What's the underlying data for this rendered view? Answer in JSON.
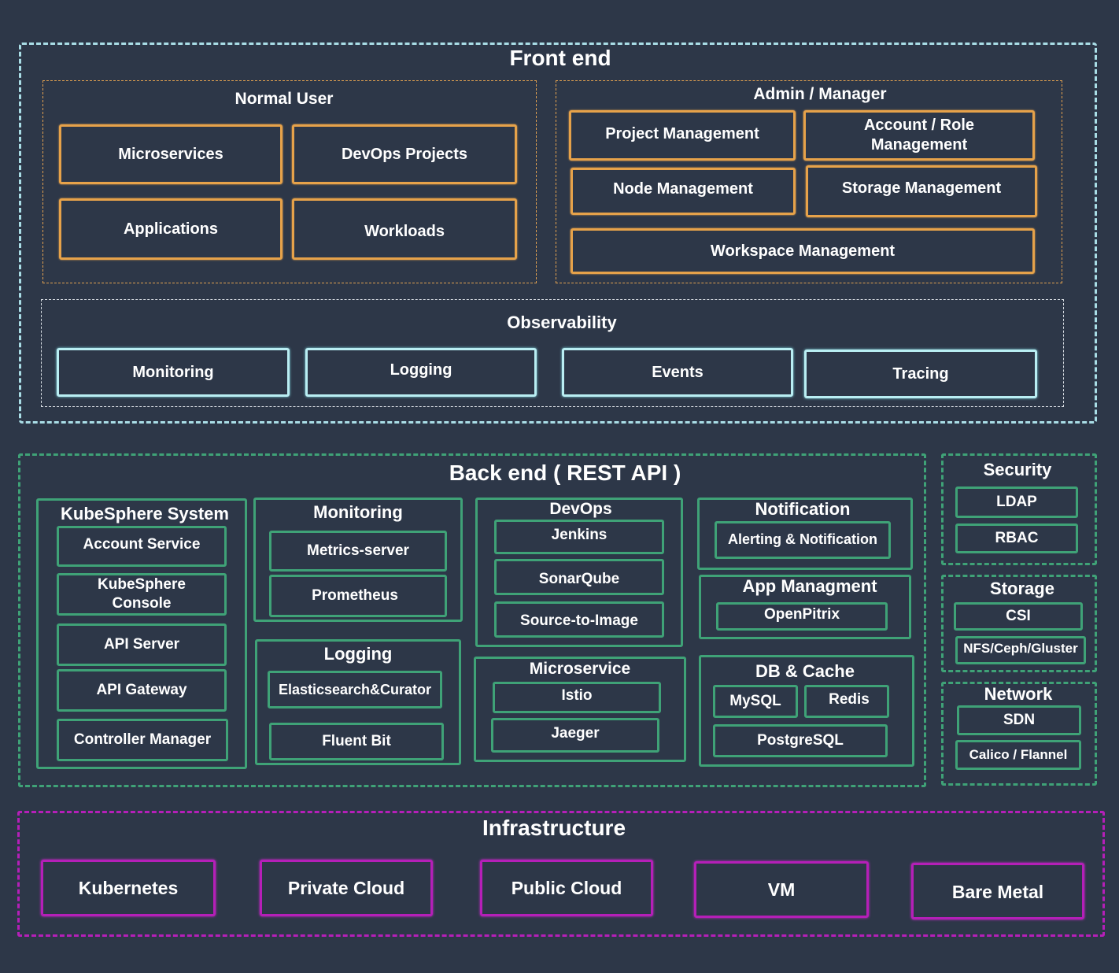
{
  "colors": {
    "background": "#2d3748",
    "front_end": "#a9dde6",
    "front_end_boxes": "#e6a24a",
    "observability": "#b9eef3",
    "back_end": "#3fa277",
    "infrastructure": "#b51fb8",
    "text": "#ffffff"
  },
  "front_end": {
    "title": "Front end",
    "normal_user": {
      "title": "Normal User",
      "items": [
        "Microservices",
        "DevOps Projects",
        "Applications",
        "Workloads"
      ]
    },
    "admin": {
      "title": "Admin / Manager",
      "items": [
        "Project Management",
        "Account / Role Management",
        "Node Management",
        "Storage Management",
        "Workspace Management"
      ]
    },
    "observability": {
      "title": "Observability",
      "items": [
        "Monitoring",
        "Logging",
        "Events",
        "Tracing"
      ]
    }
  },
  "back_end": {
    "title": "Back end ( REST API )",
    "kubesphere_system": {
      "title": "KubeSphere System",
      "items": [
        "Account Service",
        "KubeSphere Console",
        "API Server",
        "API Gateway",
        "Controller Manager"
      ]
    },
    "monitoring": {
      "title": "Monitoring",
      "items": [
        "Metrics-server",
        "Prometheus"
      ]
    },
    "logging": {
      "title": "Logging",
      "items": [
        "Elasticsearch&Curator",
        "Fluent Bit"
      ]
    },
    "devops": {
      "title": "DevOps",
      "items": [
        "Jenkins",
        "SonarQube",
        "Source-to-Image"
      ]
    },
    "microservice": {
      "title": "Microservice",
      "items": [
        "Istio",
        "Jaeger"
      ]
    },
    "notification": {
      "title": "Notification",
      "items": [
        "Alerting & Notification"
      ]
    },
    "app_management": {
      "title": "App Managment",
      "items": [
        "OpenPitrix"
      ]
    },
    "db_cache": {
      "title": "DB & Cache",
      "items": [
        "MySQL",
        "Redis",
        "PostgreSQL"
      ]
    }
  },
  "side": {
    "security": {
      "title": "Security",
      "items": [
        "LDAP",
        "RBAC"
      ]
    },
    "storage": {
      "title": "Storage",
      "items": [
        "CSI",
        "NFS/Ceph/Gluster"
      ]
    },
    "network": {
      "title": "Network",
      "items": [
        "SDN",
        "Calico / Flannel"
      ]
    }
  },
  "infrastructure": {
    "title": "Infrastructure",
    "items": [
      "Kubernetes",
      "Private Cloud",
      "Public Cloud",
      "VM",
      "Bare Metal"
    ]
  }
}
